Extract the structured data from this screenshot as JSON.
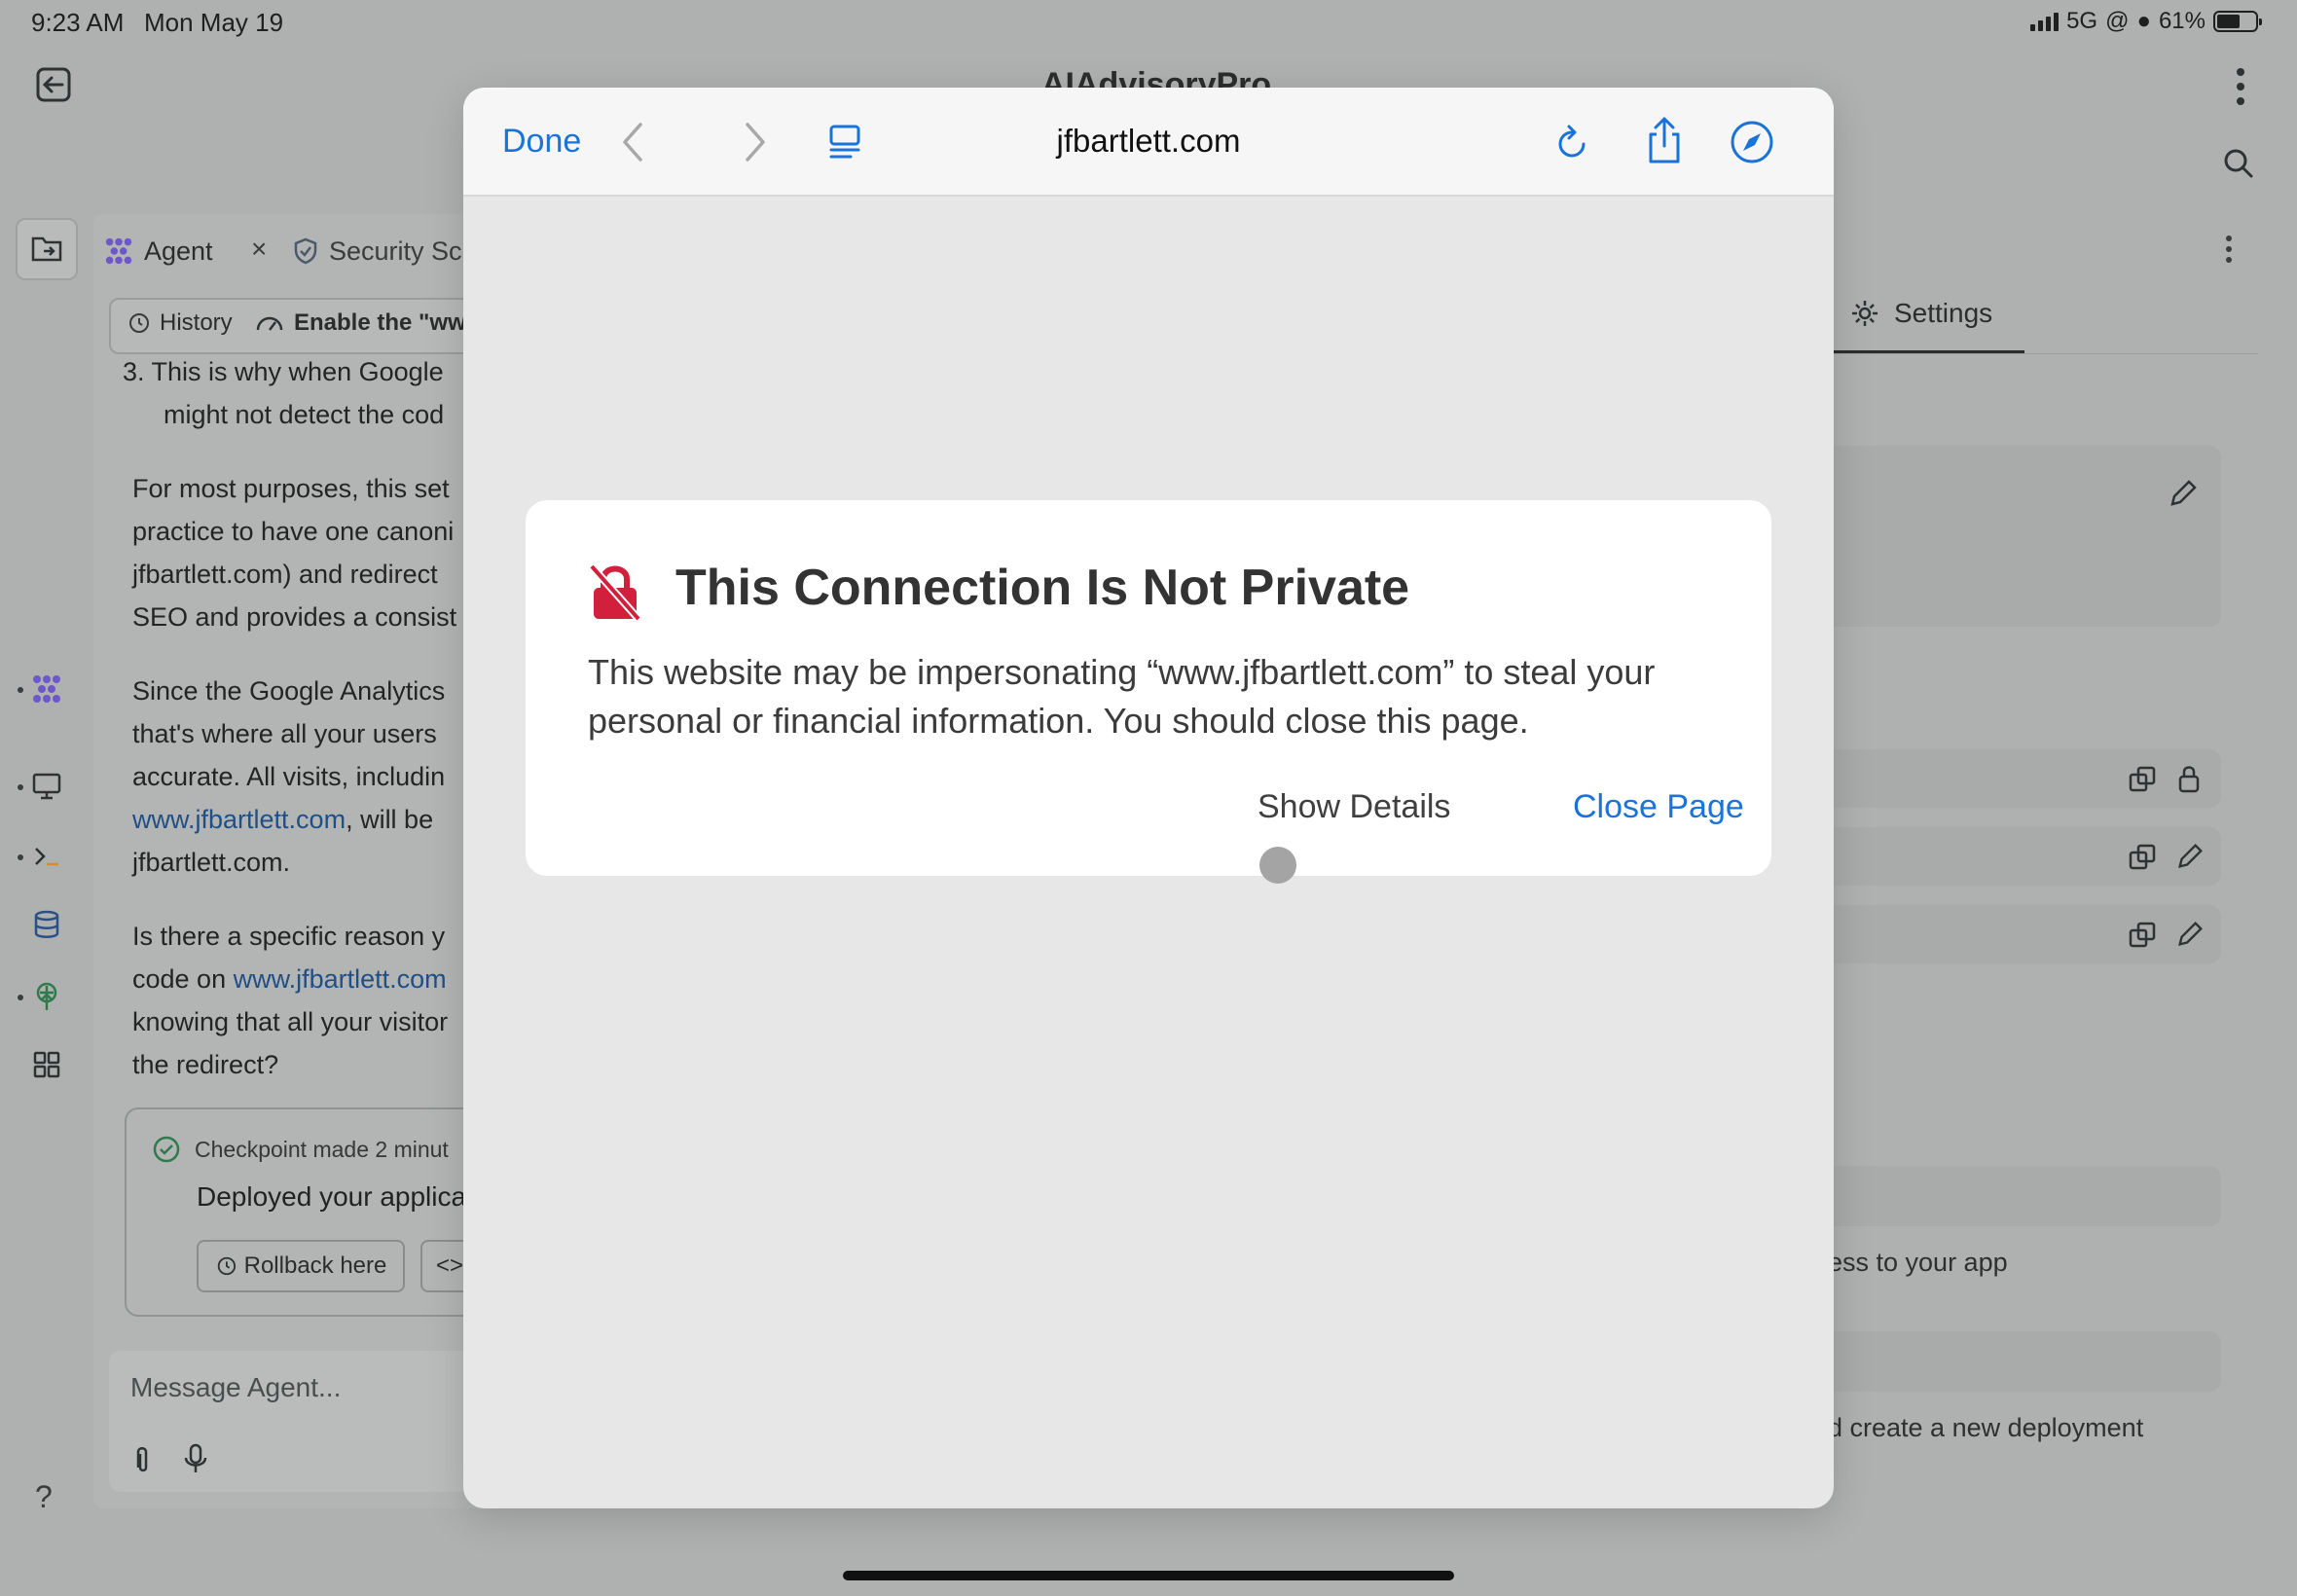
{
  "status_bar": {
    "time": "9:23 AM",
    "date": "Mon May 19",
    "network": "5G",
    "battery": "61%",
    "battery_level": 0.61
  },
  "app": {
    "title": "AIAdvisoryPro"
  },
  "tabs": {
    "agent_label": "Agent",
    "security_label": "Security Sc"
  },
  "history_bar": {
    "history_label": "History",
    "task_label": "Enable the \"ww"
  },
  "chat": {
    "lines": [
      "3.  This is why when Google",
      "might not detect the cod",
      "For most purposes, this set",
      "practice to have one canoni",
      "jfbartlett.com) and redirect",
      "SEO and provides a consist",
      "Since the Google Analytics",
      "that's where all your users",
      "accurate. All visits, includin",
      "www.jfbartlett.com",
      ", will be",
      "jfbartlett.com.",
      "Is there a specific reason y",
      "code on ",
      "www.jfbartlett.com",
      "knowing that all your visitor",
      "the redirect?"
    ]
  },
  "checkpoint": {
    "title": "Checkpoint made 2 minut",
    "body": "Deployed your applica",
    "rollback_label": "Rollback here",
    "code_label": "<>"
  },
  "composer": {
    "placeholder": "Message Agent..."
  },
  "help": "?",
  "right_pane": {
    "settings_label": "Settings",
    "text_1": "ess to your app",
    "text_2": "d create a new deployment"
  },
  "safari": {
    "done_label": "Done",
    "url": "jfbartlett.com",
    "accent_color": "#1a73d9"
  },
  "warning": {
    "title": "This Connection Is Not Private",
    "body": "This website may be impersonating “www.jfbartlett.com” to steal your personal or financial information. You should close this page.",
    "show_details_label": "Show Details",
    "close_page_label": "Close Page",
    "lock_color": "#d21f3c"
  }
}
